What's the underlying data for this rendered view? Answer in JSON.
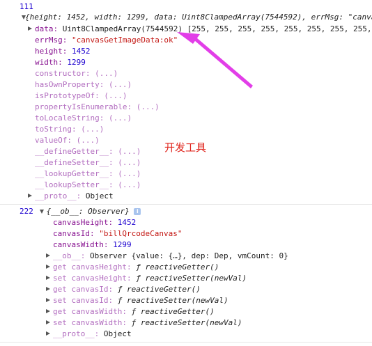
{
  "log1": {
    "prefix": "111",
    "summary": "{height: 1452, width: 1299, data: Uint8ClampedArray(7544592), errMsg: \"canva",
    "data_key": "data:",
    "data_type": "Uint8ClampedArray(7544592)",
    "data_values": "[255, 255, 255, 255, 255, 255, 255, 255,",
    "errMsg_key": "errMsg:",
    "errMsg_val": "\"canvasGetImageData:ok\"",
    "height_key": "height:",
    "height_val": "1452",
    "width_key": "width:",
    "width_val": "1299",
    "methods": [
      "constructor: (...)",
      "hasOwnProperty: (...)",
      "isPrototypeOf: (...)",
      "propertyIsEnumerable: (...)",
      "toLocaleString: (...)",
      "toString: (...)",
      "valueOf: (...)",
      "__defineGetter__: (...)",
      "__defineSetter__: (...)",
      "__lookupGetter__: (...)",
      "__lookupSetter__: (...)"
    ],
    "proto_key": "__proto__:",
    "proto_val": "Object"
  },
  "annotation": {
    "label": "开发工具",
    "arrow_color": "#e23ee8"
  },
  "log2": {
    "prefix": "222",
    "summary": "{__ob__: Observer}",
    "info_icon": "i",
    "canvasHeight_key": "canvasHeight:",
    "canvasHeight_val": "1452",
    "canvasId_key": "canvasId:",
    "canvasId_val": "\"billQrcodeCanvas\"",
    "canvasWidth_key": "canvasWidth:",
    "canvasWidth_val": "1299",
    "ob_key": "__ob__:",
    "ob_val": "Observer {value: {…}, dep: Dep, vmCount: 0}",
    "accessors": [
      {
        "name": "get canvasHeight:",
        "fn": "ƒ reactiveGetter()"
      },
      {
        "name": "set canvasHeight:",
        "fn": "ƒ reactiveSetter(newVal)"
      },
      {
        "name": "get canvasId:",
        "fn": "ƒ reactiveGetter()"
      },
      {
        "name": "set canvasId:",
        "fn": "ƒ reactiveSetter(newVal)"
      },
      {
        "name": "get canvasWidth:",
        "fn": "ƒ reactiveGetter()"
      },
      {
        "name": "set canvasWidth:",
        "fn": "ƒ reactiveSetter(newVal)"
      }
    ],
    "proto_key": "__proto__:",
    "proto_val": "Object"
  }
}
